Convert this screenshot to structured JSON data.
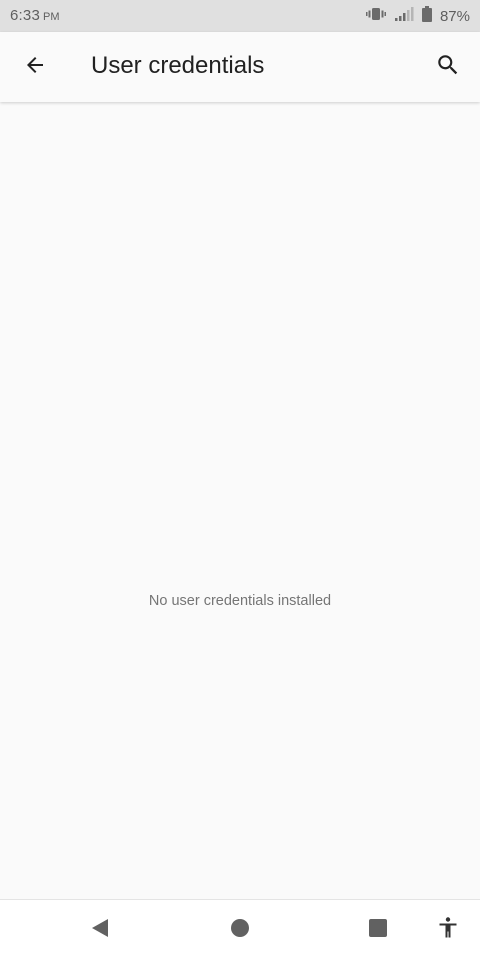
{
  "status_bar": {
    "time": "6:33",
    "ampm": "PM",
    "battery": "87%",
    "icons": [
      "vibrate-icon",
      "signal-icon",
      "battery-icon"
    ]
  },
  "app_bar": {
    "title": "User credentials",
    "back_icon": "arrow-back-icon",
    "search_icon": "search-icon"
  },
  "content": {
    "empty_message": "No user credentials installed"
  },
  "nav_bar": {
    "icons": [
      "back-triangle-icon",
      "home-circle-icon",
      "recents-square-icon",
      "accessibility-icon"
    ]
  },
  "colors": {
    "status_bar_bg": "#e0e0e0",
    "background": "#fafafa",
    "title": "#212121",
    "empty_text": "#757575",
    "nav_icons": "#616161"
  }
}
